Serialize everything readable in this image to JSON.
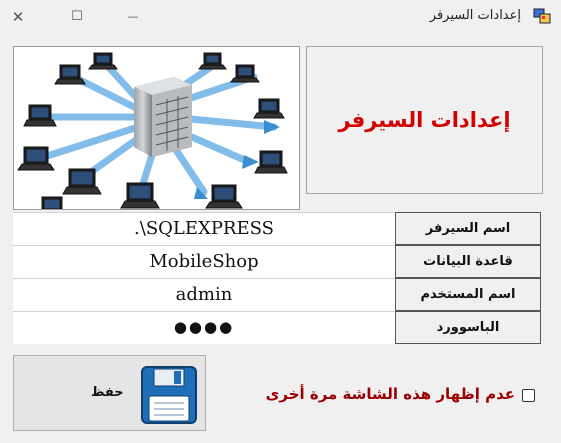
{
  "window": {
    "title": "إعدادات السيرفر",
    "close_glyph": "✕",
    "maximize_glyph": "☐",
    "minimize_glyph": "—"
  },
  "header": {
    "title": "إعدادات السيرفر",
    "title_color": "#d40000"
  },
  "fields": [
    {
      "label": "اسم السيرفر",
      "value": ".\\SQLEXPRESS"
    },
    {
      "label": "قاعدة البيانات",
      "value": "MobileShop"
    },
    {
      "label": "اسم المستخدم",
      "value": "admin"
    },
    {
      "label": "الباسوورد",
      "value": "●●●●"
    }
  ],
  "save_button": {
    "label": "حفظ",
    "icon": "floppy-disk-icon"
  },
  "checkbox": {
    "label": "عدم إظهار هذه الشاشة مرة أخرى",
    "checked": false,
    "label_color": "#9a0000"
  },
  "picture": {
    "icon": "server-network-icon"
  }
}
